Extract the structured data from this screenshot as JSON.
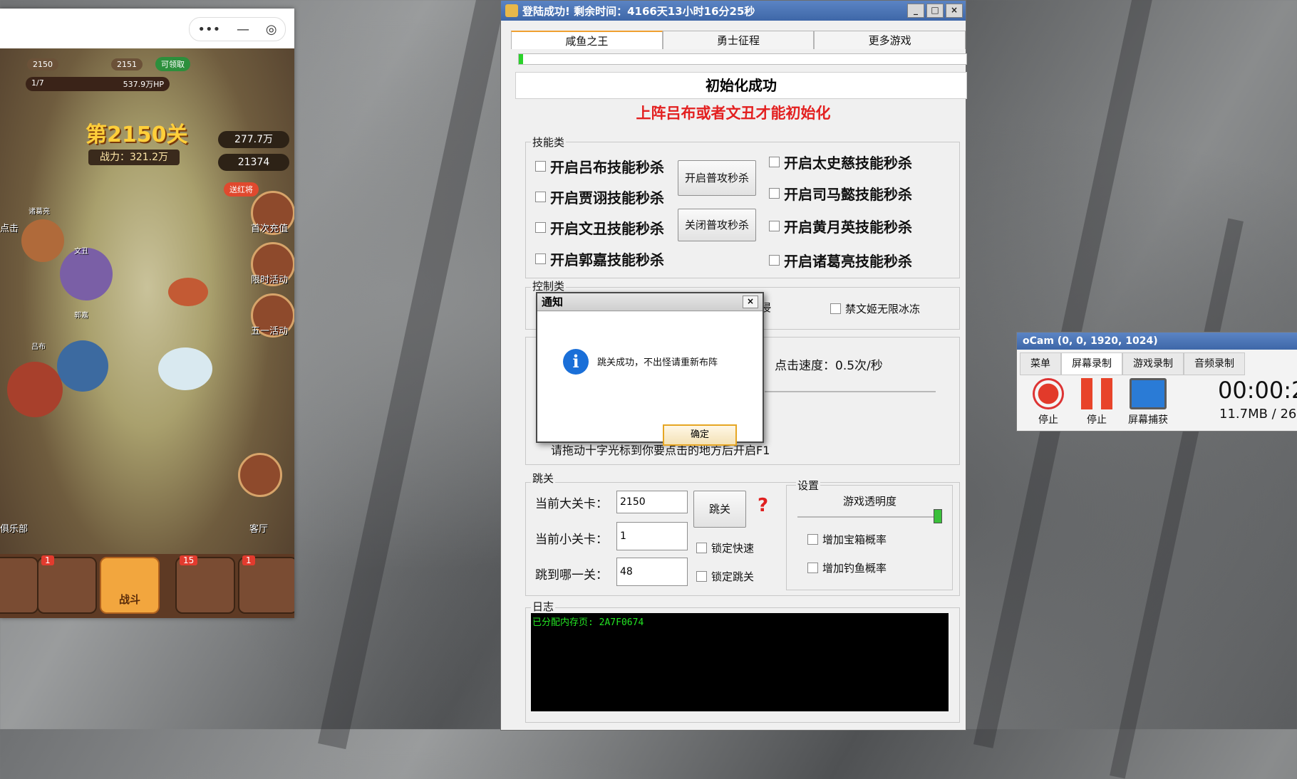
{
  "game": {
    "stage_title": "第2150关",
    "power": "战力：321.2万",
    "left_level": "2150",
    "right_level": "2151",
    "claim_label": "可领取",
    "progress_text": "1/7",
    "hp_text": "537.9万HP",
    "gold": "277.7万",
    "gems": "21374",
    "red_badge": "送红将",
    "side_labels": [
      "首次充值",
      "限时活动",
      "五一活动",
      "客厅"
    ],
    "left_labels": [
      "点击",
      "俱乐部"
    ],
    "nav_label": "战斗",
    "nav_badges": [
      "1",
      "15",
      "1"
    ],
    "hero_names": [
      "诸葛亮",
      "文丑",
      "郭嘉",
      "吕布"
    ]
  },
  "tool": {
    "title": "登陆成功! 剩余时间：4166天13小时16分25秒",
    "tabs": [
      "咸鱼之王",
      "勇士征程",
      "更多游戏"
    ],
    "progress_percent": 1,
    "status": "初始化成功",
    "warning": "上阵吕布或者文丑才能初始化",
    "skill_group": "技能类",
    "skills_left": [
      "开启吕布技能秒杀",
      "开启贾诩技能秒杀",
      "开启文丑技能秒杀",
      "开启郭嘉技能秒杀"
    ],
    "skills_right": [
      "开启太史慈技能秒杀",
      "开启司马懿技能秒杀",
      "开启黄月英技能秒杀",
      "开启诸葛亮技能秒杀"
    ],
    "btn_open_attack": "开启普攻秒杀",
    "btn_close_attack": "关闭普攻秒杀",
    "control_group": "控制类",
    "control_partial": "浸",
    "control_option": "禁文姬无限冰冻",
    "click_speed": "点击速度：0.5次/秒",
    "drag_hint": "请拖动十字光标到你要点击的地方后开启F1",
    "jump_group": "跳关",
    "label_big": "当前大关卡：",
    "label_small": "当前小关卡：",
    "label_target": "跳到哪一关：",
    "value_big": "2150",
    "value_small": "1",
    "value_target": "48",
    "btn_jump": "跳关",
    "help_mark": "?",
    "lock_fast": "锁定快速",
    "lock_jump": "锁定跳关",
    "settings_group": "设置",
    "transparency": "游戏透明度",
    "transparency_value": 0.98,
    "chk_chest": "增加宝箱概率",
    "chk_fish": "增加钓鱼概率",
    "log_group": "日志",
    "log_text": "已分配内存页: 2A7F0674"
  },
  "dialog": {
    "title": "通知",
    "close": "×",
    "icon": "i",
    "message": "跳关成功，不出怪请重新布阵",
    "ok": "确定"
  },
  "ocam": {
    "title": "oCam (0, 0, 1920, 1024)",
    "tabs": [
      "菜单",
      "屏幕录制",
      "游戏录制",
      "音频录制"
    ],
    "btn_stop1": "停止",
    "btn_stop2": "停止",
    "btn_capture": "屏幕捕获",
    "time": "00:00:2",
    "size": "11.7MB / 26"
  }
}
